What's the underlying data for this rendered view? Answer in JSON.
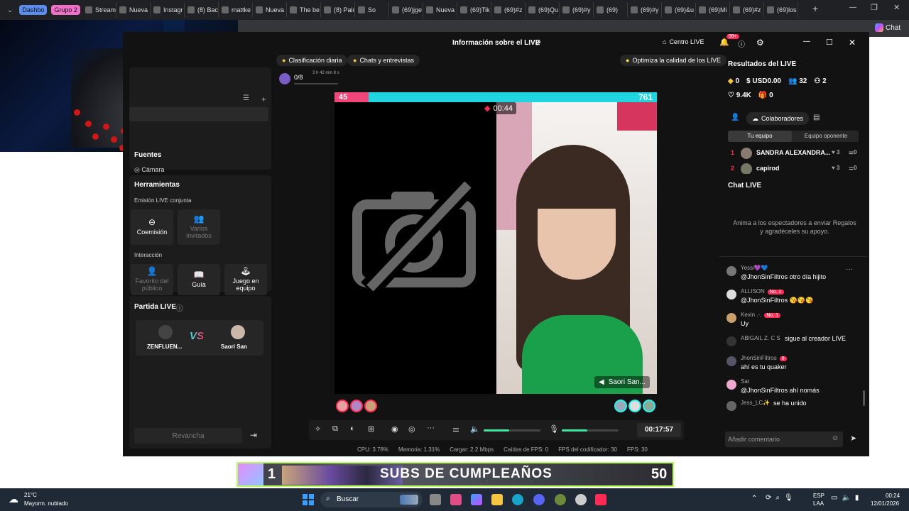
{
  "browser": {
    "tab_groups": [
      {
        "label": "Dashbo",
        "color": "#5b8def"
      },
      {
        "label": "Grupo 2",
        "color": "#f06fc8"
      }
    ],
    "tabs": [
      "Stream",
      "Nueva",
      "Instagr",
      "(8) Bac",
      "mattke",
      "Nueva",
      "The be",
      "(8) Palo",
      "So",
      "(69)jge",
      "Nueva",
      "(69)Tik",
      "(69)#z",
      "(69)Qu",
      "(69)#y",
      "(69)",
      "(69)#y",
      "(69)&u",
      "(69)Mi",
      "(69)#z",
      "(69)los"
    ],
    "chat_label": "Chat"
  },
  "app": {
    "title": "Información sobre el LIVE",
    "live_center": "Centro LIVE",
    "notif_count": "99+",
    "daily_ranking": "Clasificación diaria",
    "chats_interviews": "Chats y entrevistas",
    "optimize": "Optimiza la calidad de los LIVE",
    "goal_count": "0/8",
    "goal_time": "3 h 42 min 8 s"
  },
  "left": {
    "sources_title": "Fuentes",
    "camera": "Cámara",
    "tools_title": "Herramientas",
    "joint_broadcast": "Emisión LIVE conjunta",
    "coemission": "Coemisión",
    "multi_guests": "Varios invitados",
    "interaction": "Interacción",
    "public_fav": "Favorito del público",
    "guide": "Guía",
    "team_game": "Juego en equipo",
    "match_title": "Partida LIVE",
    "player1": "ZENFLUEN...",
    "player2": "Saori San",
    "rematch": "Revancha"
  },
  "video": {
    "score_left": "45",
    "score_right": "761",
    "timer": "00:44",
    "guest_name": "Saori San..."
  },
  "controls": {
    "elapsed": "00:17:57",
    "volume_level": 0.45,
    "mic_level": 0.45
  },
  "stats": {
    "cpu": "CPU: 3.78%",
    "memory": "Memoria: 1.31%",
    "load": "Cargar: 2.2 Mbps",
    "fps_drops": "Caídas de FPS: 0",
    "encoder_fps": "FPS del codificador: 30",
    "fps": "FPS: 30"
  },
  "results": {
    "title": "Resultados del LIVE",
    "diamonds": "0",
    "usd": "USD0.00",
    "viewers": "32",
    "shares": "2",
    "likes": "9.4K",
    "gifts": "0",
    "collaborators": "Colaboradores",
    "tab_my_team": "Tu equipo",
    "tab_opponent": "Equipo oponente",
    "team": [
      {
        "rank": "1",
        "name": "SANDRA ALEXANDRA...",
        "likes": "3",
        "score": "0"
      },
      {
        "rank": "2",
        "name": "capirod",
        "likes": "3",
        "score": "0"
      }
    ]
  },
  "chat": {
    "title": "Chat LIVE",
    "empty_hint": "Anima a los espectadores a enviar Regalos y agradéceles su apoyo.",
    "placeholder": "Añadir comentario",
    "messages": [
      {
        "name": "Yessi💜💙",
        "text": "@JhonSinFiltros otro día hijito",
        "color": "#777"
      },
      {
        "name": "ALLISON",
        "badge": "No. 2",
        "text": "@JhonSinFiltros 😘😘😘",
        "color": "#ddd"
      },
      {
        "name": "Kevin .-.",
        "badge": "No. 1",
        "text": "Uy",
        "color": "#c9a06a"
      },
      {
        "name": "ABIGAIL Z. C S",
        "text": "sigue al creador LIVE",
        "color": "#333"
      },
      {
        "name": "JhonSinFiltros",
        "badge": "8",
        "text": "ahí es tu quaker",
        "color": "#556"
      },
      {
        "name": "Sat",
        "text": "@JhonSinFiltros ahí nomás",
        "color": "#f0a8d0"
      },
      {
        "name": "Jess_LC✨",
        "text": "se ha unido",
        "color": "#666"
      }
    ]
  },
  "banner": {
    "number": "1",
    "text": "SUBS DE CUMPLEAÑOS",
    "count": "50"
  },
  "taskbar": {
    "temperature": "21°C",
    "weather": "Mayorm. nublado",
    "search": "Buscar",
    "lang1": "ESP",
    "lang2": "LAA",
    "time": "00:24",
    "date": "12/01/2026"
  }
}
